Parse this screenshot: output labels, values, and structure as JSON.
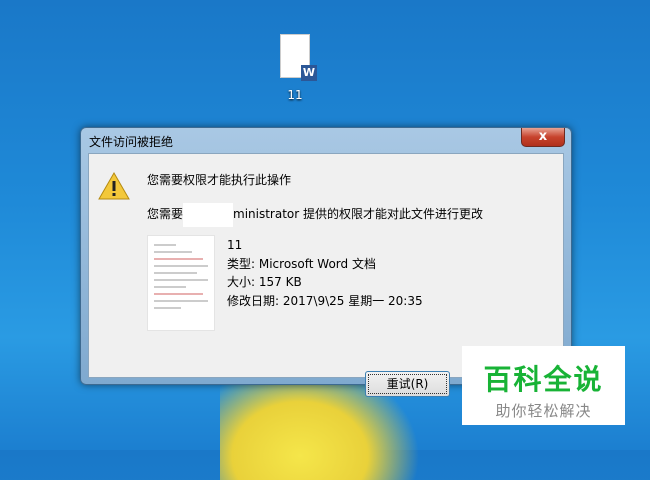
{
  "desktop": {
    "icon_label": "11",
    "icon_badge": "W"
  },
  "dialog": {
    "title": "文件访问被拒绝",
    "close_label": "x",
    "heading": "您需要权限才能执行此操作",
    "message_prefix": "您需要",
    "message_suffix": "ministrator 提供的权限才能对此文件进行更改",
    "file": {
      "name": "11",
      "type": "类型: Microsoft Word 文档",
      "size": "大小: 157 KB",
      "modified": "修改日期: 2017\\9\\25 星期一 20:35"
    },
    "retry_label": "重试(R)"
  },
  "watermark": {
    "title": "百科全说",
    "subtitle": "助你轻松解决"
  }
}
